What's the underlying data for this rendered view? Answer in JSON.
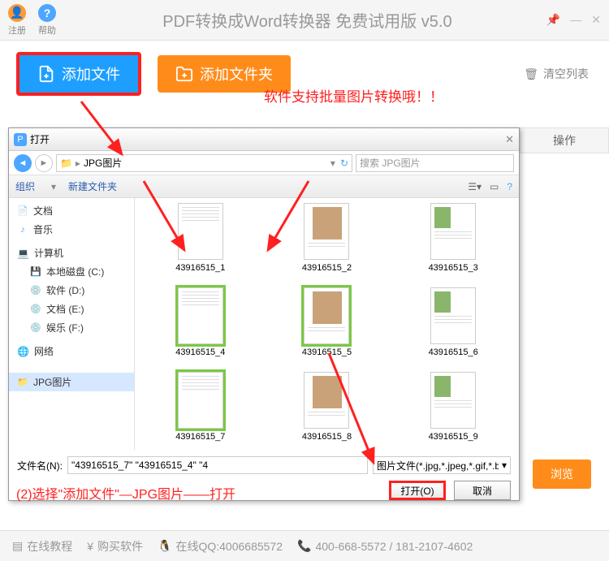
{
  "app": {
    "register": "注册",
    "help": "帮助",
    "title": "PDF转换成Word转换器 免费试用版 v5.0"
  },
  "actions": {
    "add_file": "添加文件",
    "add_folder": "添加文件夹",
    "clear_list": "清空列表",
    "note": "软件支持批量图片转换哦！！"
  },
  "right": {
    "operate": "操作",
    "browse": "浏览"
  },
  "dialog": {
    "title": "打开",
    "path_folder": "JPG图片",
    "search_placeholder": "搜索 JPG图片",
    "organize": "组织",
    "new_folder": "新建文件夹",
    "sidebar": {
      "docs": "文档",
      "music": "音乐",
      "computer": "计算机",
      "local_c": "本地磁盘 (C:)",
      "soft_d": "软件 (D:)",
      "doc_e": "文档 (E:)",
      "ent_f": "娱乐 (F:)",
      "network": "网络",
      "jpg_folder": "JPG图片"
    },
    "files": [
      {
        "name": "43916515_1",
        "selected": false
      },
      {
        "name": "43916515_2",
        "selected": false
      },
      {
        "name": "43916515_3",
        "selected": false
      },
      {
        "name": "43916515_4",
        "selected": true
      },
      {
        "name": "43916515_5",
        "selected": true
      },
      {
        "name": "43916515_6",
        "selected": false
      },
      {
        "name": "43916515_7",
        "selected": true
      },
      {
        "name": "43916515_8",
        "selected": false
      },
      {
        "name": "43916515_9",
        "selected": false
      }
    ],
    "filename_label": "文件名(N):",
    "filename_value": "\"43916515_7\" \"43916515_4\" \"4",
    "filter": "图片文件(*.jpg,*.jpeg,*.gif,*.bmp)",
    "open_btn": "打开(O)",
    "cancel_btn": "取消"
  },
  "instruction": "(2)选择\"添加文件\"—JPG图片——打开",
  "bottom": {
    "tutorial": "在线教程",
    "buy": "购买软件",
    "qq": "在线QQ:4006685572",
    "phone": "400-668-5572 / 181-2107-4602"
  }
}
